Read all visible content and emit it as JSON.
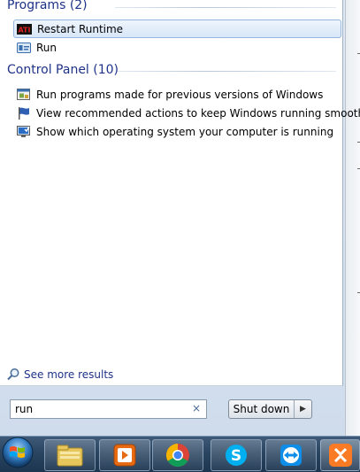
{
  "programs": {
    "header": "Programs (2)",
    "items": [
      {
        "label": "Restart Runtime",
        "icon": "amd-logo-icon",
        "selected": true
      },
      {
        "label": "Run",
        "icon": "run-dialog-icon",
        "selected": false
      }
    ]
  },
  "control_panel": {
    "header": "Control Panel (10)",
    "items": [
      {
        "label": "Run programs made for previous versions of Windows",
        "icon": "compatibility-icon"
      },
      {
        "label": "View recommended actions to keep Windows running smoothly",
        "icon": "action-center-flag-icon"
      },
      {
        "label": "Show which operating system your computer is running",
        "icon": "system-info-icon"
      }
    ]
  },
  "see_more": "See more results",
  "search": {
    "value": "run",
    "clear": "×"
  },
  "shutdown": {
    "label": "Shut down",
    "arrow": "▶"
  },
  "taskbar": {
    "items": [
      "windows-explorer-icon",
      "media-player-icon",
      "chrome-icon",
      "skype-icon",
      "teamviewer-icon",
      "xampp-icon"
    ]
  },
  "colors": {
    "header_text": "#1e3287",
    "selection_border": "#98b6dc",
    "taskbar": "#2a4561"
  }
}
